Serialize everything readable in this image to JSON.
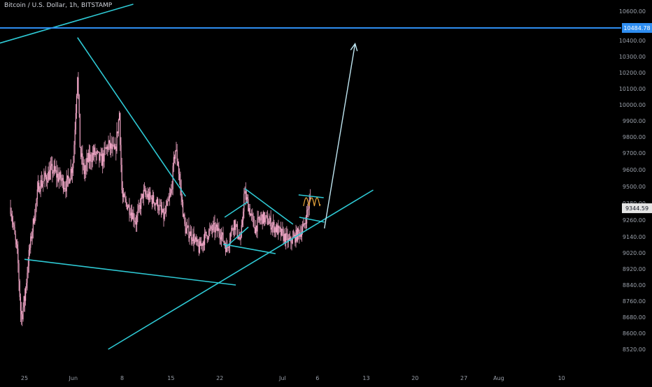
{
  "header": {
    "symbol_title": "Bitcoin / U.S. Dollar, 1h, BITSTAMP"
  },
  "colors": {
    "background": "#000000",
    "candle": "#f0a6c6",
    "trendline": "#2ec9d4",
    "resistance": "#2e8df0",
    "projection_arrow": "#bfe6f2",
    "forecast_squiggle": "#e8a63c",
    "axis_text": "#9aa0aa",
    "price_badge_bg": "#e4e4e4",
    "resistance_badge_bg": "#2e8df0"
  },
  "price_badges": {
    "resistance_level": "10484.78",
    "last_price": "9344.59"
  },
  "chart_data": {
    "type": "candlestick",
    "symbol": "BTCUSD",
    "interval": "1h",
    "exchange": "BITSTAMP",
    "ylim": [
      8480,
      10640
    ],
    "y_ticks": [
      "10600.00",
      "10400.00",
      "10300.00",
      "10200.00",
      "10100.00",
      "10000.00",
      "9900.00",
      "9800.00",
      "9700.00",
      "9600.00",
      "9500.00",
      "9380.00",
      "9260.00",
      "9140.00",
      "9020.00",
      "8920.00",
      "8840.00",
      "8760.00",
      "8680.00",
      "8600.00",
      "8520.00"
    ],
    "x_ticks": [
      "25",
      "Jun",
      "8",
      "15",
      "22",
      "Jul",
      "6",
      "13",
      "20",
      "27",
      "Aug",
      "10"
    ],
    "last_price": 9344.59,
    "resistance_level": 10484.78,
    "price_path": [
      [
        23.0,
        9350
      ],
      [
        24.0,
        9000
      ],
      [
        24.5,
        8680
      ],
      [
        25.0,
        8760
      ],
      [
        26.0,
        9150
      ],
      [
        27.0,
        9500
      ],
      [
        28.0,
        9550
      ],
      [
        29.0,
        9600
      ],
      [
        30.0,
        9550
      ],
      [
        31.0,
        9500
      ],
      [
        32.0,
        9650
      ],
      [
        32.6,
        10200
      ],
      [
        33.0,
        9700
      ],
      [
        33.6,
        9580
      ],
      [
        34.0,
        9650
      ],
      [
        35.0,
        9700
      ],
      [
        36.0,
        9650
      ],
      [
        37.0,
        9750
      ],
      [
        38.0,
        9700
      ],
      [
        38.6,
        9950
      ],
      [
        39.0,
        9420
      ],
      [
        40.0,
        9350
      ],
      [
        41.0,
        9250
      ],
      [
        42.0,
        9450
      ],
      [
        43.0,
        9420
      ],
      [
        44.0,
        9380
      ],
      [
        45.0,
        9280
      ],
      [
        46.0,
        9450
      ],
      [
        46.6,
        9730
      ],
      [
        47.0,
        9640
      ],
      [
        48.0,
        9200
      ],
      [
        49.0,
        9150
      ],
      [
        50.0,
        9050
      ],
      [
        51.0,
        9150
      ],
      [
        52.0,
        9200
      ],
      [
        53.0,
        9180
      ],
      [
        54.0,
        9050
      ],
      [
        55.0,
        9250
      ],
      [
        56.0,
        9100
      ],
      [
        56.5,
        9450
      ],
      [
        57.0,
        9380
      ],
      [
        58.0,
        9200
      ],
      [
        59.0,
        9280
      ],
      [
        60.0,
        9250
      ],
      [
        61.0,
        9200
      ],
      [
        62.0,
        9150
      ],
      [
        63.0,
        9100
      ],
      [
        64.0,
        9150
      ],
      [
        65.0,
        9200
      ],
      [
        66.0,
        9420
      ]
    ],
    "drawings": [
      {
        "kind": "trendline",
        "from": [
          32.6,
          10420
        ],
        "to": [
          48.1,
          9430
        ]
      },
      {
        "kind": "trendline",
        "from": [
          18.0,
          10340
        ],
        "to": [
          40.6,
          10650
        ]
      },
      {
        "kind": "trendline",
        "from": [
          25.0,
          8980
        ],
        "to": [
          55.3,
          8840
        ]
      },
      {
        "kind": "trendline",
        "from": [
          37.0,
          8520
        ],
        "to": [
          75.0,
          9475
        ]
      },
      {
        "kind": "trendline",
        "from": [
          56.6,
          9485
        ],
        "to": [
          63.5,
          9230
        ]
      },
      {
        "kind": "trendline",
        "from": [
          53.5,
          9085
        ],
        "to": [
          61.0,
          9015
        ]
      },
      {
        "kind": "trendline",
        "from": [
          53.7,
          9280
        ],
        "to": [
          57.0,
          9390
        ]
      },
      {
        "kind": "trendline",
        "from": [
          53.8,
          9060
        ],
        "to": [
          57.1,
          9210
        ]
      },
      {
        "kind": "trendline",
        "from": [
          64.3,
          9440
        ],
        "to": [
          67.9,
          9420
        ]
      },
      {
        "kind": "trendline",
        "from": [
          64.4,
          9280
        ],
        "to": [
          68.0,
          9245
        ]
      },
      {
        "kind": "horizontal_line",
        "price": 10484.78
      },
      {
        "kind": "arrow",
        "from": [
          68.0,
          9200
        ],
        "to": [
          72.4,
          10380
        ]
      }
    ],
    "grid": false
  }
}
